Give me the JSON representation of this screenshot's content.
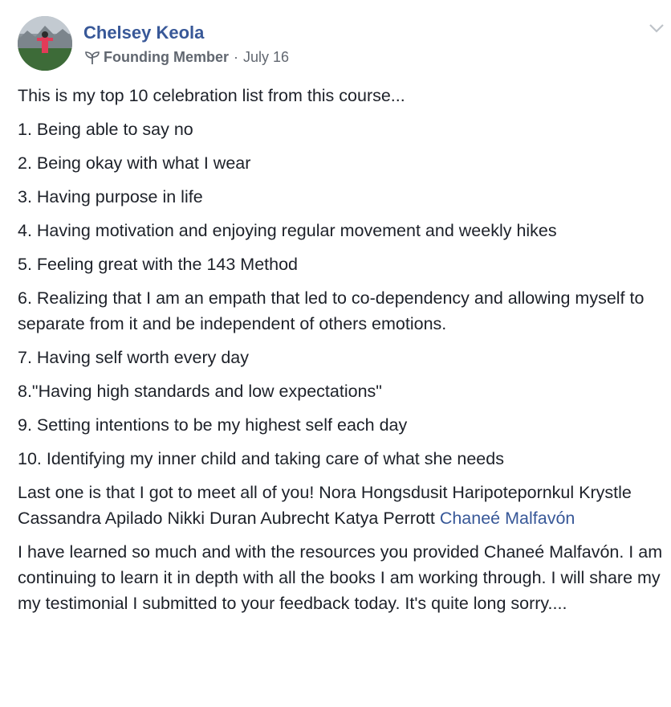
{
  "post": {
    "author": "Chelsey Keola",
    "badge": "Founding Member",
    "separator": "·",
    "date": "July 16",
    "intro": "This is my top 10 celebration list from this course...",
    "list": [
      "1. Being able to say no",
      "2. Being okay with what I wear",
      "3. Having purpose in life",
      "4. Having motivation and enjoying regular movement and weekly hikes",
      "5. Feeling great with the 143 Method",
      "6. Realizing that I am an empath that led to co-dependency and allowing myself to separate from it and be independent of others emotions.",
      "7. Having self worth every day",
      "8.\"Having high standards and low expectations\"",
      "9. Setting intentions to be my highest self each day",
      "10. Identifying my inner child and taking care of what she needs"
    ],
    "closing_text": "Last one is that I got to meet all of you! Nora Hongsdusit Haripotepornkul Krystle Cassandra Apilado Nikki Duran Aubrecht Katya Perrott ",
    "closing_tag": "Chaneé Malfavón",
    "final": "I have learned so much and with the resources you provided Chaneé Malfavón. I am continuing to learn it in depth with all the books I am working through. I will share my my testimonial I submitted to your feedback today. It's quite long sorry....",
    "icons": {
      "badge": "sprout-icon",
      "menu": "chevron-down-icon"
    },
    "colors": {
      "link": "#385898",
      "text": "#1d2129",
      "meta": "#616770"
    }
  }
}
